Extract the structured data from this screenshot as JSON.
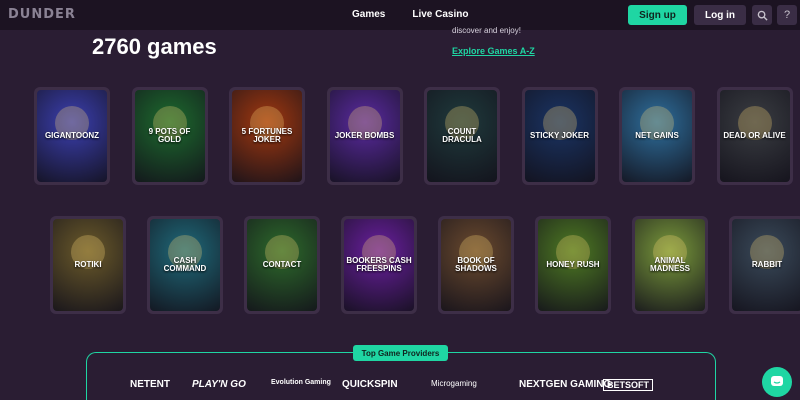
{
  "header": {
    "logo": "DUNDER",
    "nav": [
      "Games",
      "Live Casino"
    ],
    "signup": "Sign up",
    "login": "Log in",
    "search_icon": "search-icon",
    "help_label": "?"
  },
  "hero": {
    "games_count": "2760 games",
    "partial_text": "discover and enjoy!",
    "explore_link": "Explore Games A-Z"
  },
  "games_row1": [
    {
      "title": "GIGANTOONZ",
      "bg": "#3b3fb0"
    },
    {
      "title": "9 POTS OF GOLD",
      "bg": "#1d6b2e"
    },
    {
      "title": "5 FORTUNES JOKER",
      "bg": "#a2380f"
    },
    {
      "title": "JOKER BOMBS",
      "bg": "#5a2aa0"
    },
    {
      "title": "COUNT DRACULA",
      "bg": "#1f3a3c"
    },
    {
      "title": "STICKY JOKER",
      "bg": "#1a3464"
    },
    {
      "title": "NET GAINS",
      "bg": "#2e6f9d"
    },
    {
      "title": "DEAD OR ALIVE",
      "bg": "#3a3d42"
    }
  ],
  "games_row2": [
    {
      "title": "ROTIKI",
      "bg": "#6b5a2a"
    },
    {
      "title": "CASH COMMAND",
      "bg": "#1f6a7a"
    },
    {
      "title": "CONTACT",
      "bg": "#2d6a2b"
    },
    {
      "title": "BOOKERS CASH FREESPINS",
      "bg": "#6a1fa0"
    },
    {
      "title": "BOOK OF SHADOWS",
      "bg": "#6b4a2e"
    },
    {
      "title": "HONEY RUSH",
      "bg": "#4e7a23"
    },
    {
      "title": "ANIMAL MADNESS",
      "bg": "#7a9a3b"
    },
    {
      "title": "RABBIT",
      "bg": "#3a4a5a"
    }
  ],
  "providers": {
    "label": "Top Game Providers",
    "items": [
      "NETENT",
      "PLAY'N GO",
      "Evolution Gaming",
      "QUICKSPIN",
      "Microgaming",
      "NEXTGEN GAMING",
      "BETSOFT"
    ]
  },
  "colors": {
    "accent": "#1fd6a3",
    "background": "#2a1d33",
    "header": "#1c1322"
  }
}
